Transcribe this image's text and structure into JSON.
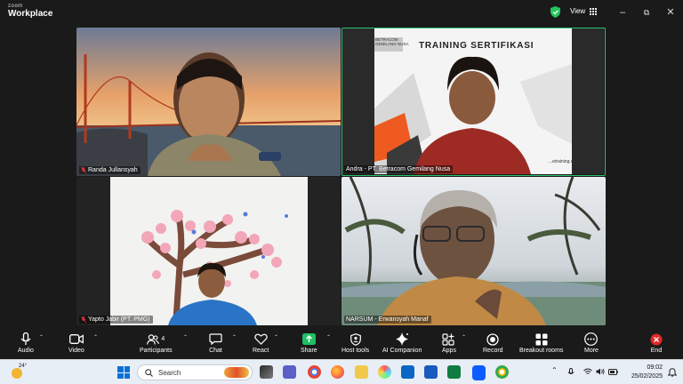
{
  "app": {
    "brand_small": "zoom",
    "brand_large": "Workplace"
  },
  "titlebar": {
    "view_label": "View"
  },
  "participants": [
    {
      "name": "Randa Jullansyah",
      "muted": true
    },
    {
      "name": "Andra - PT. Betracom Gemilang Nusa",
      "muted": false,
      "slide_title": "TRAINING SERTIFIKASI",
      "slide_logo_line1": "BETRACOM",
      "slide_logo_line2": "GEMILANG NUSA",
      "slide_footer": "...etraining.com"
    },
    {
      "name": "Yapto Jabir (PT. PMG)",
      "muted": true
    },
    {
      "name": "NARSUM - Erwansyah Manaf",
      "muted": false
    }
  ],
  "toolbar": {
    "audio": "Audio",
    "video": "Video",
    "participants": "Participants",
    "participants_count": "4",
    "chat": "Chat",
    "react": "React",
    "share": "Share",
    "host_tools": "Host tools",
    "ai_companion": "AI Companion",
    "apps": "Apps",
    "record": "Record",
    "breakout_rooms": "Breakout rooms",
    "more": "More",
    "end": "End"
  },
  "taskbar": {
    "weather_temp": "24°",
    "search_placeholder": "Search",
    "time": "09:02",
    "date": "25/02/2025"
  },
  "colors": {
    "active_speaker_border": "#27c46b",
    "share_green": "#1fbf63",
    "end_red": "#e02828",
    "accent_blue": "#0e72ed"
  }
}
